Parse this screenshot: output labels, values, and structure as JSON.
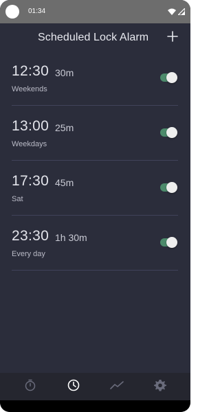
{
  "status_bar": {
    "time": "01:34"
  },
  "header": {
    "title": "Scheduled Lock Alarm",
    "add_icon": "plus-icon"
  },
  "alarms": [
    {
      "time": "12:30",
      "duration": "30m",
      "days": "Weekends",
      "enabled": true
    },
    {
      "time": "13:00",
      "duration": "25m",
      "days": "Weekdays",
      "enabled": true
    },
    {
      "time": "17:30",
      "duration": "45m",
      "days": "Sat",
      "enabled": true
    },
    {
      "time": "23:30",
      "duration": "1h 30m",
      "days": "Every day",
      "enabled": true
    }
  ],
  "bottom_nav": {
    "items": [
      {
        "icon": "timer-icon",
        "active": false
      },
      {
        "icon": "clock-icon",
        "active": true
      },
      {
        "icon": "trend-chart-icon",
        "active": false
      },
      {
        "icon": "gear-icon",
        "active": false
      }
    ]
  },
  "colors": {
    "background": "#2b2d3b",
    "toggle_on": "#4c8a6b",
    "nav_bg": "#25262f"
  }
}
